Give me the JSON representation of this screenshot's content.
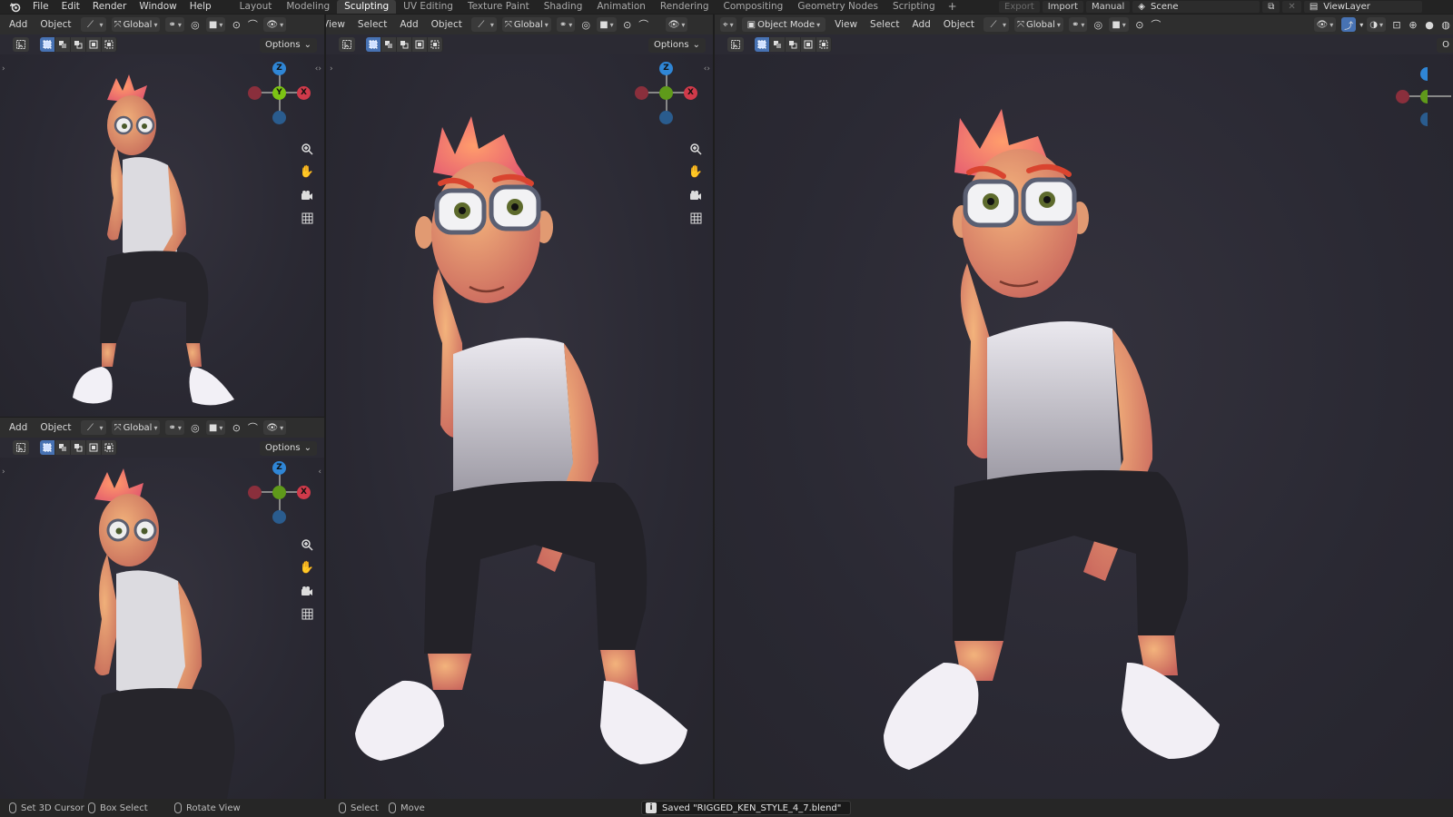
{
  "topbar": {
    "menus": [
      "File",
      "Edit",
      "Render",
      "Window",
      "Help"
    ],
    "workspaces": [
      "Layout",
      "Modeling",
      "Sculpting",
      "UV Editing",
      "Texture Paint",
      "Shading",
      "Animation",
      "Rendering",
      "Compositing",
      "Geometry Nodes",
      "Scripting"
    ],
    "active_workspace": "Sculpting",
    "add_tab": "+",
    "export_label": "Export",
    "import_label": "Import",
    "manual_label": "Manual",
    "scene_label": "Scene",
    "view_layer_label": "ViewLayer"
  },
  "viewports": {
    "top_left": {
      "header": {
        "add": "Add",
        "object": "Object",
        "orientation": "Global"
      },
      "options": "Options",
      "gizmo": {
        "z": "Z",
        "y": "Y",
        "x": "X"
      }
    },
    "bottom_left": {
      "header": {
        "add": "Add",
        "object": "Object",
        "orientation": "Global"
      },
      "options": "Options",
      "gizmo": {
        "z": "Z",
        "y": "",
        "x": "X"
      }
    },
    "middle": {
      "header": {
        "view": "View",
        "select": "Select",
        "add": "Add",
        "object": "Object",
        "orientation": "Global"
      },
      "options": "Options",
      "gizmo": {
        "z": "Z",
        "y": "",
        "x": "X"
      }
    },
    "right": {
      "header": {
        "mode": "Object Mode",
        "view": "View",
        "select": "Select",
        "add": "Add",
        "object": "Object",
        "orientation": "Global"
      },
      "options": "O"
    }
  },
  "statusbar": {
    "set_cursor": "Set 3D Cursor",
    "box_select": "Box Select",
    "rotate_view": "Rotate View",
    "select": "Select",
    "move": "Move",
    "saved_message": "Saved \"RIGGED_KEN_STYLE_4_7.blend\""
  },
  "colors": {
    "x_axis": "#d03a4a",
    "y_axis": "#7cc414",
    "z_axis": "#2f86d6",
    "active_tab": "#3d3d3d",
    "viewport_bg": "#2b2a33",
    "accent": "#4772b3"
  },
  "icons": [
    "blender-logo-icon",
    "select-box-icon",
    "zoom-icon",
    "pan-hand-icon",
    "camera-icon",
    "grid-icon",
    "info-icon",
    "mouse-icon",
    "snap-icon",
    "proportional-icon",
    "overlay-icon",
    "shading-icon"
  ]
}
